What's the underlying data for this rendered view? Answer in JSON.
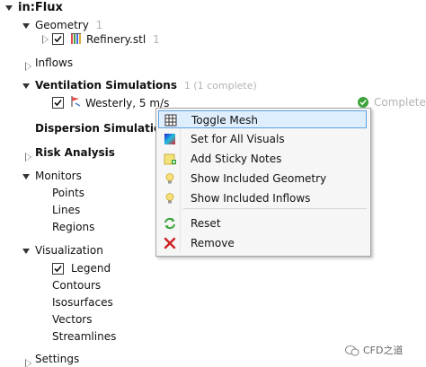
{
  "tree": {
    "root_label": "in:Flux",
    "geometry": {
      "label": "Geometry",
      "count": "1",
      "child": {
        "label": "Refinery.stl",
        "count": "1"
      }
    },
    "inflows": {
      "label": "Inflows"
    },
    "ventilation": {
      "label": "Ventilation Simulations",
      "count": "1 (1 complete)",
      "child": {
        "label": "Westerly, 5 m/s",
        "status": "Complete"
      }
    },
    "dispersion": {
      "label": "Dispersion Simulations"
    },
    "risk": {
      "label": "Risk Analysis"
    },
    "monitors": {
      "label": "Monitors",
      "children": [
        "Points",
        "Lines",
        "Regions"
      ]
    },
    "visualization": {
      "label": "Visualization",
      "legend": "Legend",
      "children": [
        "Contours",
        "Isosurfaces",
        "Vectors",
        "Streamlines"
      ]
    },
    "settings": {
      "label": "Settings"
    }
  },
  "context_menu": {
    "items": [
      {
        "label": "Toggle Mesh",
        "icon": "grid-icon"
      },
      {
        "label": "Set for All Visuals",
        "icon": "color-gradient-icon"
      },
      {
        "label": "Add Sticky Notes",
        "icon": "sticky-note-add-icon"
      },
      {
        "label": "Show Included Geometry",
        "icon": "lightbulb-icon"
      },
      {
        "label": "Show Included Inflows",
        "icon": "lightbulb-icon"
      },
      {
        "label": "Reset",
        "icon": "reset-arrows-icon"
      },
      {
        "label": "Remove",
        "icon": "red-x-icon"
      }
    ]
  },
  "watermark": {
    "text": "CFD之道"
  },
  "colors": {
    "highlight_bg": "#dfeefc",
    "highlight_border": "#5da1e6",
    "complete_green": "#3ca33c",
    "remove_red": "#d02020"
  }
}
